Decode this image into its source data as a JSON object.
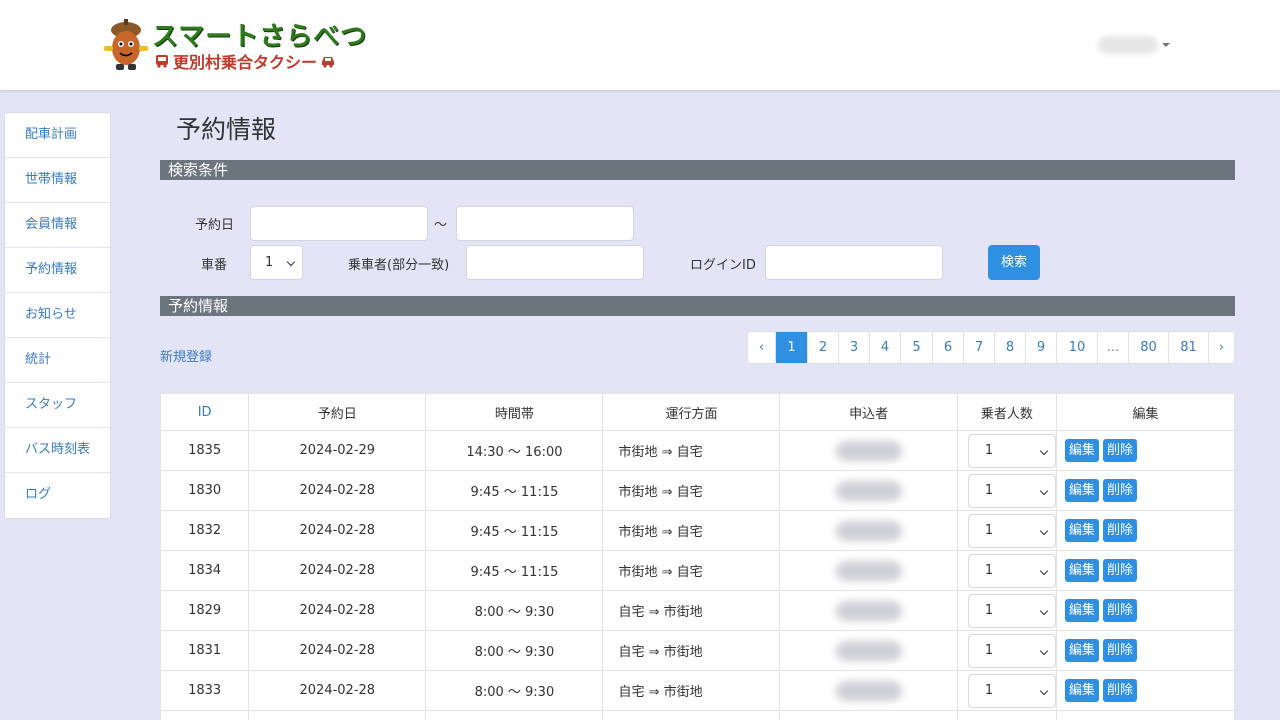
{
  "header": {
    "logo_title": "スマートさらべつ",
    "logo_subtitle": "更別村乗合タクシー"
  },
  "sidebar": {
    "items": [
      {
        "label": "配車計画"
      },
      {
        "label": "世帯情報"
      },
      {
        "label": "会員情報"
      },
      {
        "label": "予約情報"
      },
      {
        "label": "お知らせ"
      },
      {
        "label": "統計"
      },
      {
        "label": "スタッフ"
      },
      {
        "label": "バス時刻表"
      },
      {
        "label": "ログ"
      }
    ]
  },
  "main": {
    "title": "予約情報",
    "search_section": "検索条件",
    "list_section": "予約情報",
    "new_link": "新規登録"
  },
  "search": {
    "date_label": "予約日",
    "tilde": "～",
    "car_label": "車番",
    "car_value": "1",
    "passenger_label": "乗車者(部分一致)",
    "login_label": "ログインID",
    "search_button": "検索"
  },
  "pagination": [
    "‹",
    "1",
    "2",
    "3",
    "4",
    "5",
    "6",
    "7",
    "8",
    "9",
    "10",
    "...",
    "80",
    "81",
    "›"
  ],
  "pagination_active": "1",
  "table": {
    "headers": [
      "ID",
      "予約日",
      "時間帯",
      "運行方面",
      "申込者",
      "乗者人数",
      "編集"
    ],
    "edit_label": "編集",
    "delete_label": "削除",
    "rows": [
      {
        "id": "1835",
        "date": "2024-02-29",
        "time": "14:30 ～ 16:00",
        "direction": "市街地 ⇒ 自宅",
        "count": "1"
      },
      {
        "id": "1830",
        "date": "2024-02-28",
        "time": "9:45 ～ 11:15",
        "direction": "市街地 ⇒ 自宅",
        "count": "1"
      },
      {
        "id": "1832",
        "date": "2024-02-28",
        "time": "9:45 ～ 11:15",
        "direction": "市街地 ⇒ 自宅",
        "count": "1"
      },
      {
        "id": "1834",
        "date": "2024-02-28",
        "time": "9:45 ～ 11:15",
        "direction": "市街地 ⇒ 自宅",
        "count": "1"
      },
      {
        "id": "1829",
        "date": "2024-02-28",
        "time": "8:00 ～ 9:30",
        "direction": "自宅 ⇒ 市街地",
        "count": "1"
      },
      {
        "id": "1831",
        "date": "2024-02-28",
        "time": "8:00 ～ 9:30",
        "direction": "自宅 ⇒ 市街地",
        "count": "1"
      },
      {
        "id": "1833",
        "date": "2024-02-28",
        "time": "8:00 ～ 9:30",
        "direction": "自宅 ⇒ 市街地",
        "count": "1"
      }
    ]
  },
  "colors": {
    "accent": "#2f8fe0",
    "link": "#3a7cc0",
    "section_bar": "#6c757d",
    "background": "#e4e4f7",
    "logo_green": "#2f7a1c",
    "logo_red": "#c0392b"
  }
}
